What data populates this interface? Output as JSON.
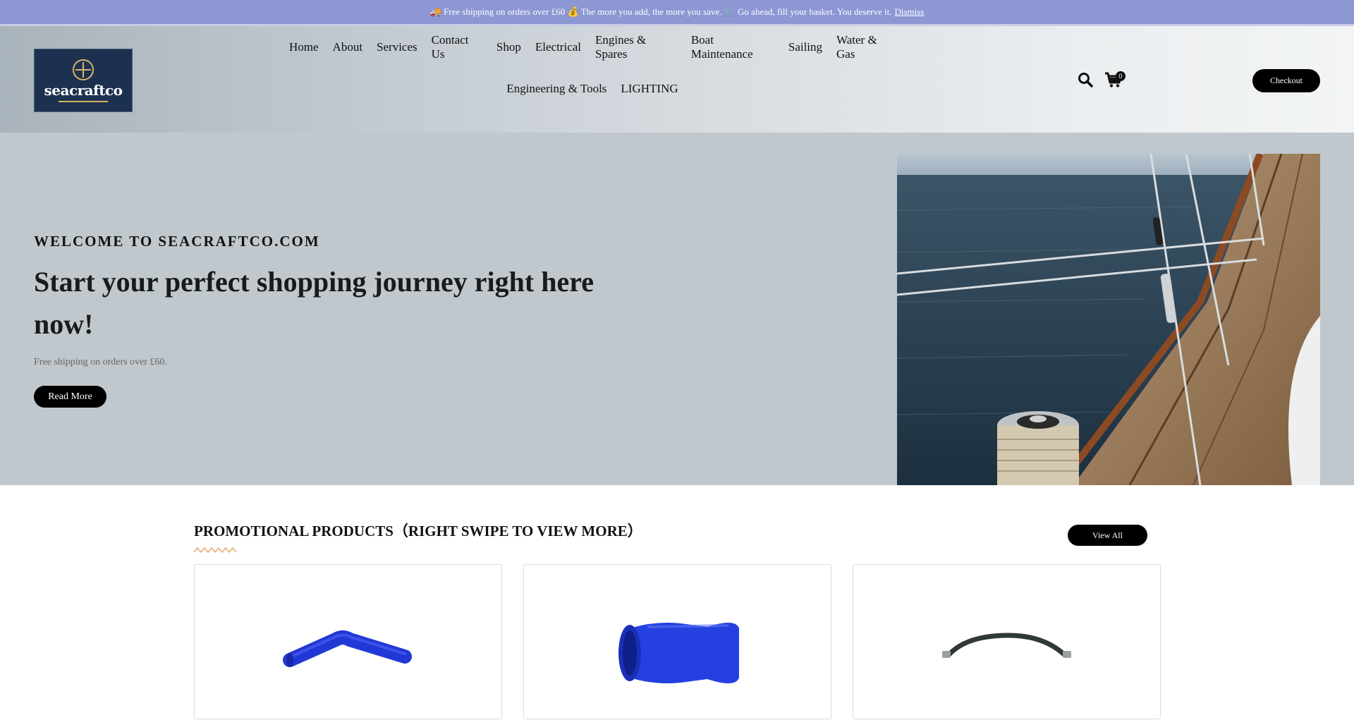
{
  "announcement": {
    "text": "🚚 Free shipping on orders over £60 💰 The more you add, the more you save. 🛒 Go ahead, fill your basket. You deserve it.",
    "dismiss_label": "Dismiss"
  },
  "header": {
    "logo_text": "seacraftco",
    "nav_row1": [
      "Home",
      "About",
      "Services",
      "Contact Us",
      "Shop",
      "Electrical",
      "Engines & Spares",
      "Boat Maintenance",
      "Sailing",
      "Water & Gas"
    ],
    "nav_row2": [
      "Engineering & Tools",
      "LIGHTING"
    ],
    "cart_count": "0",
    "checkout_label": "Checkout"
  },
  "hero": {
    "eyebrow": "WELCOME TO SEACRAFTCO.COM",
    "headline": "Start your perfect shopping journey right here now!",
    "subtext": "Free shipping on orders over £60.",
    "button_label": "Read More"
  },
  "promo": {
    "title": "PROMOTIONAL PRODUCTS（RIGHT SWIPE TO VIEW MORE）",
    "view_all_label": "View All",
    "products": [
      {
        "image": "blue-silicone-elbow-hose"
      },
      {
        "image": "blue-silicone-reducer"
      },
      {
        "image": "black-flexible-hose"
      }
    ]
  },
  "colors": {
    "announcement_bg": "#8c97d4",
    "hero_bg": "#c0c8cd",
    "button_bg": "#000000",
    "logo_bg": "#1c3150",
    "accent_zigzag": "#e8a56a"
  }
}
